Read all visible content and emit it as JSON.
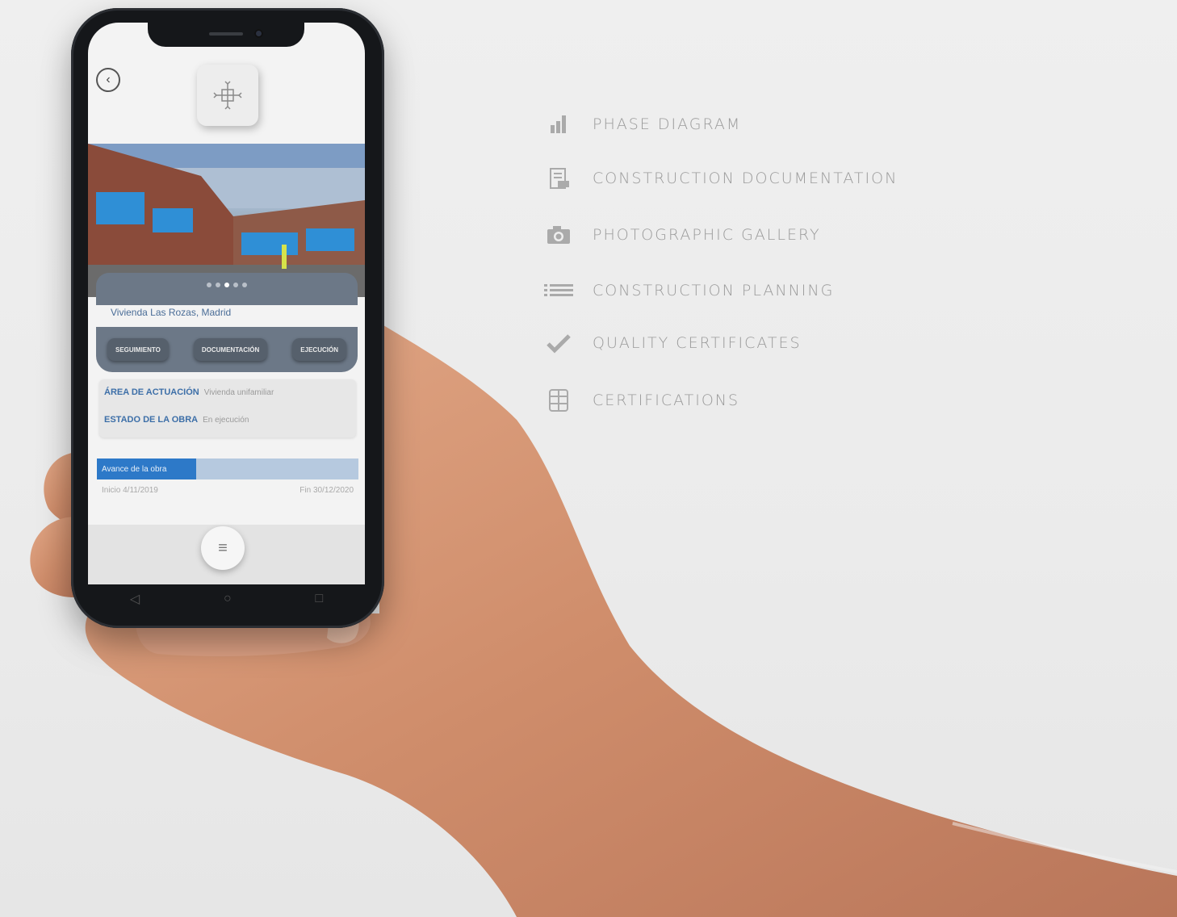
{
  "features": [
    {
      "label": "PHASE DIAGRAM",
      "icon": "bar-chart-icon"
    },
    {
      "label": "CONSTRUCTION DOCUMENTATION",
      "icon": "pdf-document-icon"
    },
    {
      "label": "PHOTOGRAPHIC GALLERY",
      "icon": "camera-icon"
    },
    {
      "label": "CONSTRUCTION PLANNING",
      "icon": "list-icon"
    },
    {
      "label": "QUALITY CERTIFICATES",
      "icon": "checkmark-icon"
    },
    {
      "label": "CERTIFICATIONS",
      "icon": "table-icon"
    }
  ],
  "app": {
    "location": "Vivienda Las Rozas, Madrid",
    "tabs": [
      "SEGUIMIENTO",
      "DOCUMENTACIÓN",
      "EJECUCIÓN"
    ],
    "area_label": "ÁREA DE ACTUACIÓN",
    "area_value": "Vivienda unifamiliar",
    "status_label": "ESTADO DE LA OBRA",
    "status_value": "En ejecución",
    "progress_label": "Avance de la obra",
    "progress_fraction": 0.38,
    "start_date": "Inicio 4/11/2019",
    "end_date": "Fin 30/12/2020",
    "pager_count": 5,
    "pager_active": 2
  },
  "colors": {
    "accent": "#2d79c8",
    "panel": "#6c7887",
    "feature_text": "#9a9a9a"
  }
}
